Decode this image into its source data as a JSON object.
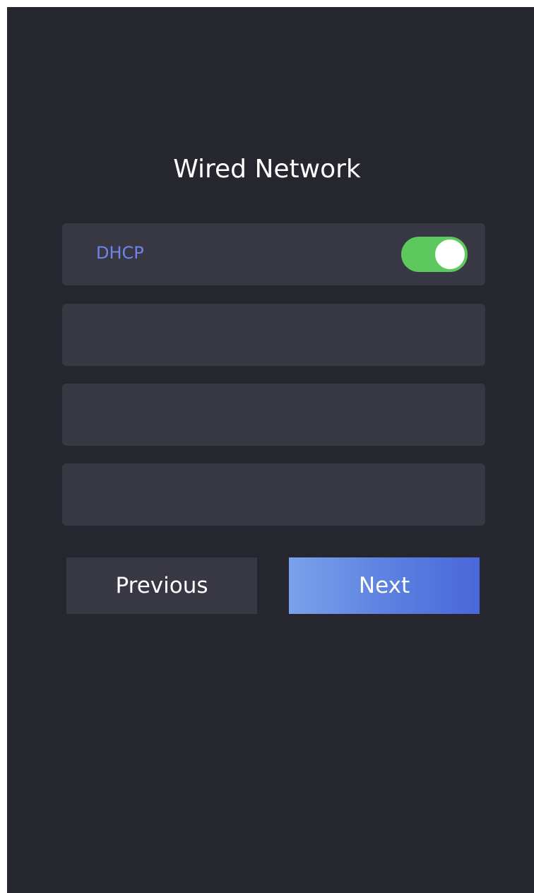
{
  "page": {
    "title": "Wired Network"
  },
  "dhcp": {
    "label": "DHCP",
    "enabled": true,
    "toggle_color": "#5cc85e",
    "label_color": "#6f84e6"
  },
  "fields": [
    {
      "value": ""
    },
    {
      "value": ""
    },
    {
      "value": ""
    }
  ],
  "buttons": {
    "previous_label": "Previous",
    "next_label": "Next"
  },
  "colors": {
    "background": "#25262e",
    "row": "#383844",
    "accent": "#5a7fe0"
  }
}
